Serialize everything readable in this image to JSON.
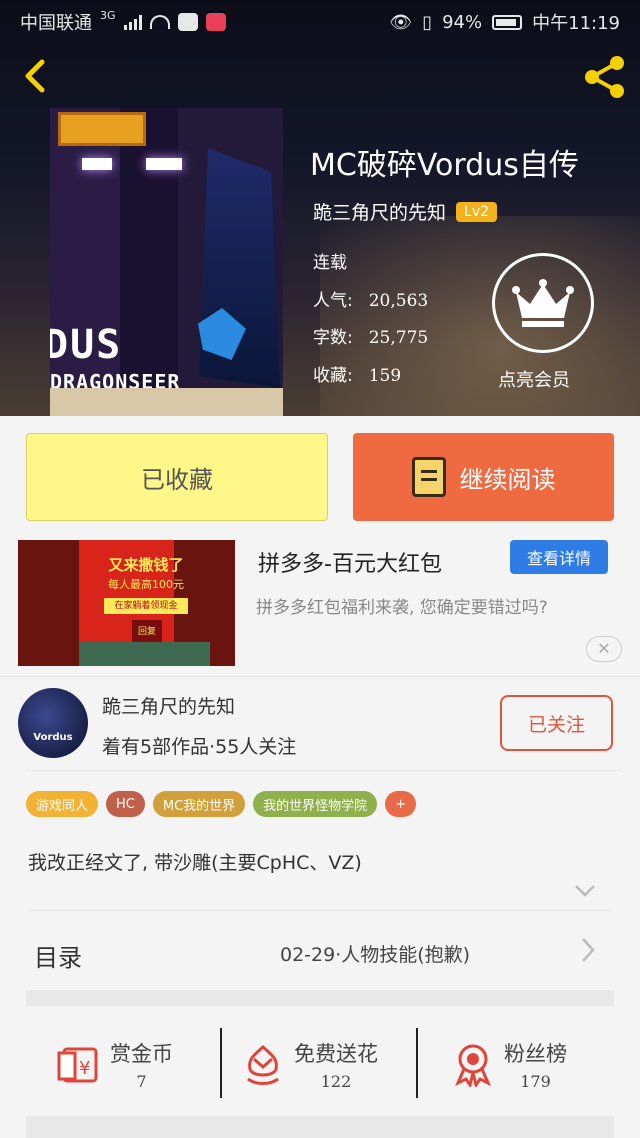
{
  "status_bar": {
    "carrier": "中国联通",
    "network": "3G",
    "battery": "94%",
    "time": "中午11:19"
  },
  "book": {
    "title": "MC破碎Vordus自传",
    "author": "跪三角尺的先知",
    "level": "Lv2",
    "status": "连载",
    "popularity_label": "人气:",
    "popularity": "20,563",
    "words_label": "字数:",
    "words": "25,775",
    "favorites_label": "收藏:",
    "favorites": "159",
    "cover_title": "DUS",
    "cover_subtitle": "DRAGONSEER"
  },
  "vip": {
    "label": "点亮会员"
  },
  "actions": {
    "collected": "已收藏",
    "continue_reading": "继续阅读"
  },
  "ad": {
    "title": "拼多多-百元大红包",
    "detail_button": "查看详情",
    "description": "拼多多红包福利来袭, 您确定要错过吗?",
    "image_text1": "又来撒钱了",
    "image_text2": "每人最高100元",
    "image_text3": "在家躺着领现金",
    "image_text4": "回复",
    "close": "✕"
  },
  "author_card": {
    "avatar_text": "Vordus",
    "name": "跪三角尺的先知",
    "meta": "着有5部作品·55人关注",
    "follow": "已关注"
  },
  "tags": [
    {
      "label": "游戏同人",
      "color": "#f2b233"
    },
    {
      "label": "HC",
      "color": "#c0604a"
    },
    {
      "label": "MC我的世界",
      "color": "#d1a03a"
    },
    {
      "label": "我的世界怪物学院",
      "color": "#8fb04a"
    },
    {
      "label": "+",
      "color": "#e86a48"
    }
  ],
  "description": "我改正经文了, 带沙雕(主要CpHC、VZ)",
  "toc": {
    "label": "目录",
    "latest": "02-29·人物技能(抱歉)"
  },
  "bottom": {
    "reward_label": "赏金币",
    "reward_value": "7",
    "flower_label": "免费送花",
    "flower_value": "122",
    "fans_label": "粉丝榜",
    "fans_value": "179"
  },
  "colors": {
    "accent_yellow": "#fff787",
    "accent_orange": "#ef6a40",
    "accent_blue": "#2f7ce6",
    "icon_red": "#e0453a"
  }
}
